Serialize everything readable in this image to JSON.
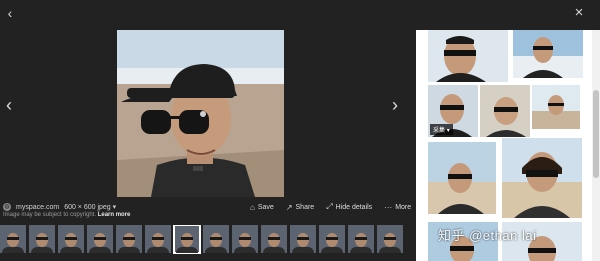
{
  "viewer": {
    "back_glyph": "‹",
    "close_glyph": "×",
    "prev_glyph": "‹",
    "next_glyph": "›"
  },
  "image_meta": {
    "site_icon": "globe-icon",
    "site": "myspace.com",
    "dims": "600 × 600 jpeg",
    "dims_dropdown": "▾",
    "copyright_text": "Image may be subject to copyright.",
    "learn_more": "Learn more"
  },
  "actions": {
    "save": {
      "icon": "bookmark-icon",
      "glyph": "⌂",
      "label": "Save"
    },
    "share": {
      "icon": "share-icon",
      "glyph": "↗",
      "label": "Share"
    },
    "hide": {
      "icon": "hide-icon",
      "glyph": "⤢",
      "label": "Hide details"
    },
    "more": {
      "icon": "more-icon",
      "glyph": "···",
      "label": "More"
    }
  },
  "related": {
    "tag": "采集",
    "tag_dropdown": "▾"
  },
  "watermark": "知乎 @ethan lai",
  "colors": {
    "background": "#222222",
    "panel": "#ffffff",
    "sky": "#c9d9e6",
    "sand": "#b8a490"
  }
}
